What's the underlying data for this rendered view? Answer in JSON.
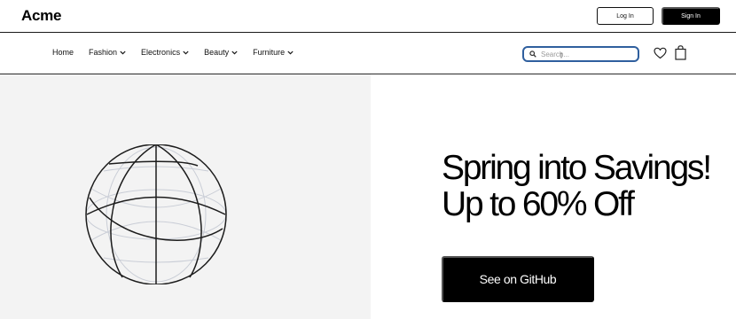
{
  "header": {
    "logo": "Acme",
    "login_label": "Log In",
    "signin_label": "Sign In"
  },
  "nav": {
    "items": [
      {
        "label": "Home",
        "has_dropdown": false
      },
      {
        "label": "Fashion",
        "has_dropdown": true
      },
      {
        "label": "Electronics",
        "has_dropdown": true
      },
      {
        "label": "Beauty",
        "has_dropdown": true
      },
      {
        "label": "Furniture",
        "has_dropdown": true
      }
    ],
    "search_placeholder": "Search...",
    "search_value": "",
    "icons": [
      "search-icon",
      "heart-icon",
      "shopping-bag-icon",
      "chevron-down-icon"
    ]
  },
  "hero": {
    "headline_line1": "Spring into Savings!",
    "headline_line2": "Up to 60% Off",
    "cta_label": "See on GitHub",
    "image": "wireframe-globe-icon"
  },
  "colors": {
    "accent_search_border": "#2f5f9e",
    "hero_left_bg": "#f3f3f3",
    "button_dark": "#000000"
  }
}
